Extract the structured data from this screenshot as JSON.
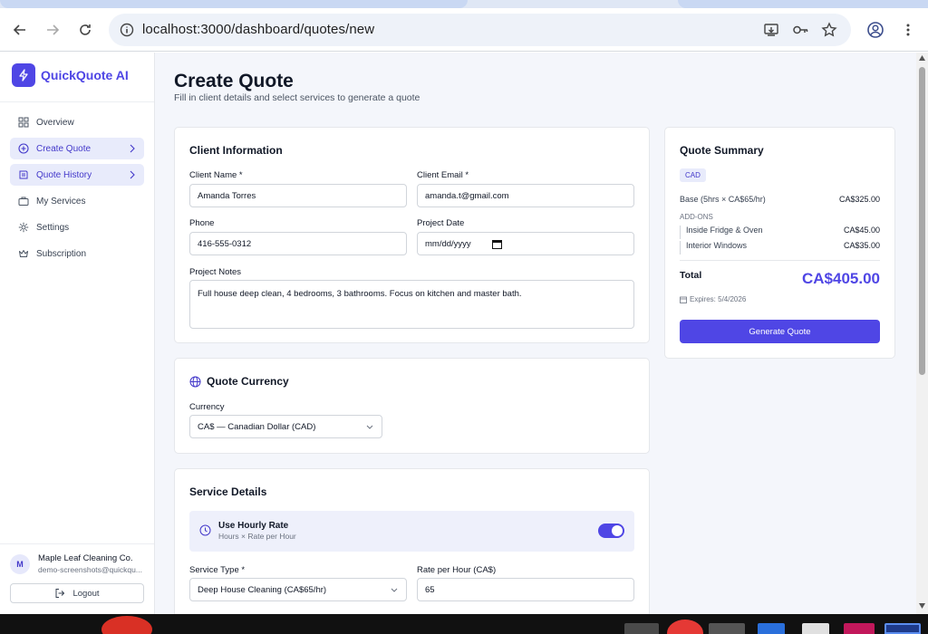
{
  "browser": {
    "url": "localhost:3000/dashboard/quotes/new"
  },
  "sidebar": {
    "brand": "QuickQuote AI",
    "items": [
      {
        "label": "Overview",
        "icon": "grid-icon"
      },
      {
        "label": "Create Quote",
        "icon": "plus-circle-icon",
        "active": true
      },
      {
        "label": "Quote History",
        "icon": "history-icon",
        "active": true
      },
      {
        "label": "My Services",
        "icon": "briefcase-icon"
      },
      {
        "label": "Settings",
        "icon": "gear-icon"
      },
      {
        "label": "Subscription",
        "icon": "crown-icon"
      }
    ],
    "user": {
      "initial": "M",
      "name": "Maple Leaf Cleaning Co.",
      "email": "demo-screenshots@quickqu..."
    },
    "logout_label": "Logout"
  },
  "page": {
    "title": "Create Quote",
    "subtitle": "Fill in client details and select services to generate a quote"
  },
  "client": {
    "title": "Client Information",
    "name_label": "Client Name *",
    "name_value": "Amanda Torres",
    "email_label": "Client Email *",
    "email_value": "amanda.t@gmail.com",
    "phone_label": "Phone",
    "phone_value": "416-555-0312",
    "date_label": "Project Date",
    "date_value": "mm/dd/yyyy",
    "notes_label": "Project Notes",
    "notes_value": "Full house deep clean, 4 bedrooms, 3 bathrooms. Focus on kitchen and master bath."
  },
  "currency": {
    "title": "Quote Currency",
    "label": "Currency",
    "value": "CA$ — Canadian Dollar (CAD)"
  },
  "service": {
    "title": "Service Details",
    "hourly_title": "Use Hourly Rate",
    "hourly_sub": "Hours × Rate per Hour",
    "hourly_on": true,
    "type_label": "Service Type *",
    "type_value": "Deep House Cleaning (CA$65/hr)",
    "rate_label": "Rate per Hour (CA$)",
    "rate_value": "65"
  },
  "summary": {
    "title": "Quote Summary",
    "badge": "CAD",
    "base_label": "Base (5hrs × CA$65/hr)",
    "base_value": "CA$325.00",
    "addons_label": "ADD-ONS",
    "addons": [
      {
        "label": "Inside Fridge & Oven",
        "value": "CA$45.00"
      },
      {
        "label": "Interior Windows",
        "value": "CA$35.00"
      }
    ],
    "total_label": "Total",
    "total_value": "CA$405.00",
    "expires": "Expires: 5/4/2026",
    "button": "Generate Quote"
  },
  "colors": {
    "accent": "#4f46e5",
    "accent_light": "#e8ebfb"
  }
}
